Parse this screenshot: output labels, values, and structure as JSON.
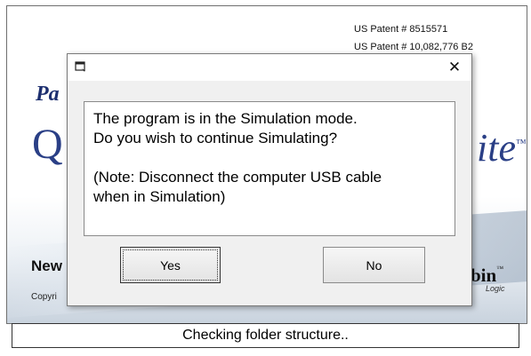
{
  "splash": {
    "patent_1": "US Patent # 8515571",
    "patent_2": "US Patent # 10,082,776 B2",
    "brand_prefix": "Pa",
    "brand_q": "Q",
    "brand_suffix": "ite",
    "brand_tm": "™",
    "new_text": "New",
    "copyright_text": "Copyri",
    "logo_text": "bin",
    "logo_tm": "™",
    "logo_sub": "Logic"
  },
  "dialog": {
    "title": "",
    "close_label": "✕",
    "message_lines": [
      "The program is in the Simulation mode.",
      "Do you wish to continue Simulating?"
    ],
    "note_lines": [
      "(Note: Disconnect the computer USB cable",
      "when in Simulation)"
    ],
    "yes_label": "Yes",
    "no_label": "No"
  },
  "status": {
    "text": "Checking folder structure.."
  },
  "colors": {
    "brand_blue": "#2a3f86",
    "dialog_bg": "#f0f0f0",
    "status_border": "#333333"
  },
  "icons": {
    "dialog_icon": "window-icon",
    "close_icon": "close-icon"
  }
}
